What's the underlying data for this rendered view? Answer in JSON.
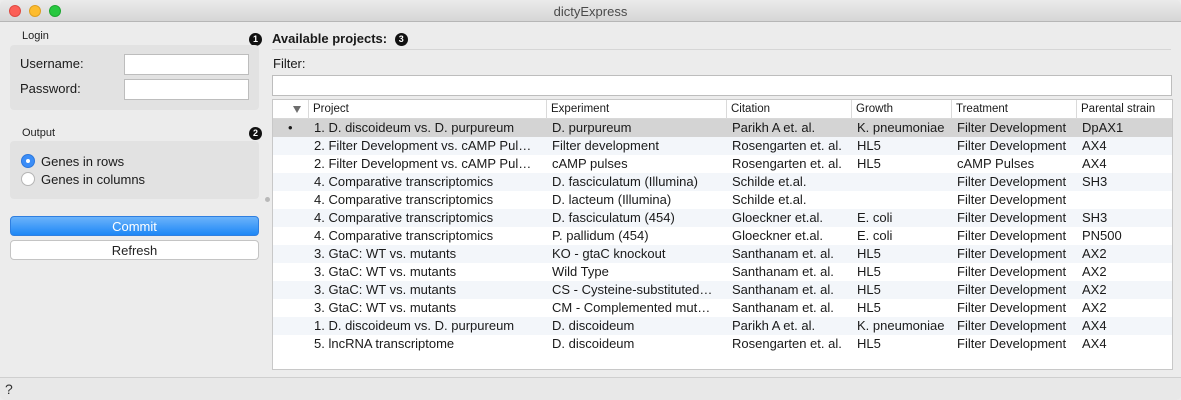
{
  "window": {
    "title": "dictyExpress"
  },
  "login": {
    "group_label": "Login",
    "badge": "1",
    "username_label": "Username:",
    "username_value": "",
    "password_label": "Password:",
    "password_value": ""
  },
  "output": {
    "group_label": "Output",
    "badge": "2",
    "options": [
      {
        "label": "Genes in rows",
        "selected": true
      },
      {
        "label": "Genes in columns",
        "selected": false
      }
    ]
  },
  "buttons": {
    "commit": "Commit",
    "refresh": "Refresh"
  },
  "projects": {
    "title": "Available projects:",
    "badge": "3",
    "filter_label": "Filter:",
    "filter_value": "",
    "columns": [
      "Project",
      "Experiment",
      "Citation",
      "Growth",
      "Treatment",
      "Parental strain"
    ],
    "selected_marker": "•",
    "rows": [
      [
        "1.  D. discoideum vs. D. purpureum",
        "D. purpureum",
        "Parikh A et. al.",
        "K. pneumoniae",
        "Filter Development",
        "DpAX1"
      ],
      [
        "2.  Filter Development vs. cAMP Pul…",
        "Filter development",
        "Rosengarten et. al.",
        "HL5",
        "Filter Development",
        "AX4"
      ],
      [
        "2.  Filter Development vs. cAMP Pul…",
        "cAMP pulses",
        "Rosengarten et. al.",
        "HL5",
        "cAMP Pulses",
        "AX4"
      ],
      [
        "4.  Comparative transcriptomics",
        "D. fasciculatum (Illumina)",
        "Schilde et.al.",
        "",
        "Filter Development",
        "SH3"
      ],
      [
        "4.  Comparative transcriptomics",
        "D. lacteum (Illumina)",
        "Schilde et.al.",
        "",
        "Filter Development",
        ""
      ],
      [
        "4.  Comparative transcriptomics",
        "D. fasciculatum (454)",
        "Gloeckner et.al.",
        "E. coli",
        "Filter Development",
        "SH3"
      ],
      [
        "4.  Comparative transcriptomics",
        "P. pallidum (454)",
        "Gloeckner et.al.",
        "E. coli",
        "Filter Development",
        "PN500"
      ],
      [
        "3.  GtaC: WT vs. mutants",
        "KO - gtaC knockout",
        "Santhanam et. al.",
        "HL5",
        "Filter Development",
        "AX2"
      ],
      [
        "3.  GtaC: WT vs. mutants",
        "Wild Type",
        "Santhanam et. al.",
        "HL5",
        "Filter Development",
        "AX2"
      ],
      [
        "3.  GtaC: WT vs. mutants",
        "CS - Cysteine-substituted…",
        "Santhanam et. al.",
        "HL5",
        "Filter Development",
        "AX2"
      ],
      [
        "3.  GtaC: WT vs. mutants",
        "CM - Complemented mut…",
        "Santhanam et. al.",
        "HL5",
        "Filter Development",
        "AX2"
      ],
      [
        "1.  D. discoideum vs. D. purpureum",
        "D. discoideum",
        "Parikh A et. al.",
        "K. pneumoniae",
        "Filter Development",
        "AX4"
      ],
      [
        "5.  lncRNA transcriptome",
        "D. discoideum",
        "Rosengarten et. al.",
        "HL5",
        "Filter Development",
        "AX4"
      ]
    ]
  },
  "status": {
    "help_icon": "?"
  }
}
